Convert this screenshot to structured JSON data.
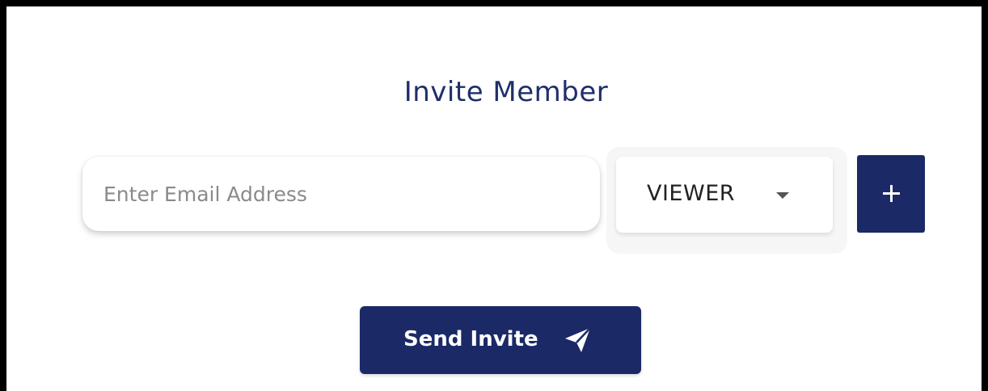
{
  "dialog": {
    "title": "Invite Member"
  },
  "form": {
    "email": {
      "placeholder": "Enter Email Address",
      "value": ""
    },
    "role": {
      "selected": "VIEWER"
    },
    "add_icon": "plus-icon",
    "send_button": {
      "label": "Send Invite",
      "icon": "send-icon"
    }
  },
  "colors": {
    "primary": "#1b2a66",
    "title": "#1f2f6b",
    "background": "#ffffff",
    "border": "#000000"
  }
}
